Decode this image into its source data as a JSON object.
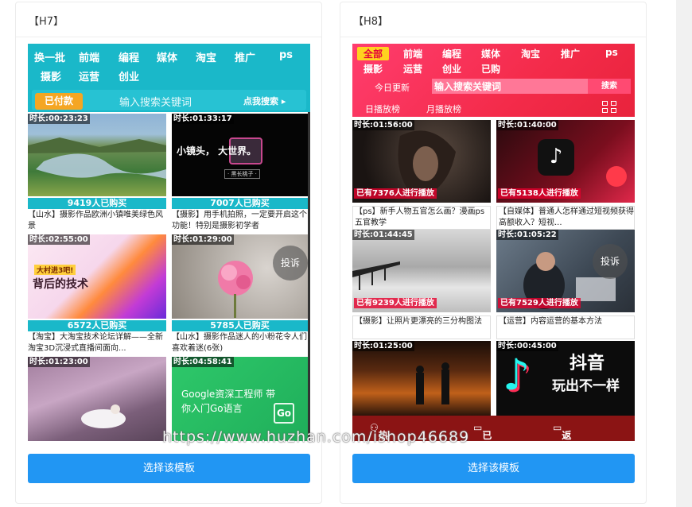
{
  "templates": [
    {
      "title": "【H7】",
      "nav": [
        "换一批",
        "前端",
        "编程",
        "媒体",
        "淘宝",
        "推广",
        "ps",
        "摄影",
        "运营",
        "创业"
      ],
      "paid_label": "已付款",
      "search_placeholder": "输入搜索关键词",
      "search_button": "点我搜索",
      "items": [
        {
          "duration": "时长:00:23:23",
          "buyers": "9419人已购买",
          "caption": "【山水】摄影作品欧洲小镇唯美绿色风景"
        },
        {
          "duration": "时长:01:33:17",
          "buyers": "7007人已购买",
          "caption": "【摄影】用手机拍照，一定要开启这个功能！特别是摄影初学者",
          "overlay_text": "小镜头，    大世界。",
          "overlay_sub": "· 黑长桃子 ·"
        },
        {
          "duration": "时长:02:55:00",
          "buyers": "6572人已购买",
          "caption": "【淘宝】大淘宝技术论坛详解——全新淘宝3D沉浸式直播间面向...",
          "overlay_text": "背后的技术",
          "overlay_tag": "大村进3吧!"
        },
        {
          "duration": "时长:01:29:00",
          "buyers": "5785人已购买",
          "caption": "【山水】摄影作品迷人的小粉花令人们喜欢着迷(6张)",
          "report": "投诉"
        },
        {
          "duration": "时长:01:23:00"
        },
        {
          "duration": "时长:04:58:41",
          "overlay_text": "Google资深工程师 带你入门Go语言",
          "overlay_badge": "Go"
        }
      ],
      "choose_button": "选择该模板"
    },
    {
      "title": "【H8】",
      "nav": [
        "全部",
        "前端",
        "编程",
        "媒体",
        "淘宝",
        "推广",
        "ps",
        "摄影",
        "运营",
        "创业",
        "已购"
      ],
      "update_label": "今日更新",
      "search_placeholder": "输入搜索关键词",
      "search_button": "搜索",
      "daily_rank": "日播放榜",
      "monthly_rank": "月播放榜",
      "items": [
        {
          "duration": "时长:01:56:00",
          "played": "已有7376人进行播放",
          "caption": "【ps】新手人物五官怎么画？漫画ps五官教学"
        },
        {
          "duration": "时长:01:40:00",
          "played": "已有5138人进行播放",
          "caption": "【自媒体】普通人怎样通过短视频获得高额收入？短视..."
        },
        {
          "duration": "时长:01:44:45",
          "played": "已有9239人进行播放",
          "caption": "【摄影】让照片更漂亮的三分构图法"
        },
        {
          "duration": "时长:01:05:22",
          "played": "已有7529人进行播放",
          "caption": "【运营】内容运营的基本方法",
          "report": "投诉"
        },
        {
          "duration": "时长:01:25:00"
        },
        {
          "duration": "时长:00:45:00",
          "overlay_text": "抖音",
          "overlay_sub": "玩出不一样"
        }
      ],
      "footer": [
        "热门推荐",
        "已购",
        "返回顶部"
      ],
      "choose_button": "选择该模板"
    }
  ],
  "watermark": "https://www.huzhan.com/ishop46689"
}
